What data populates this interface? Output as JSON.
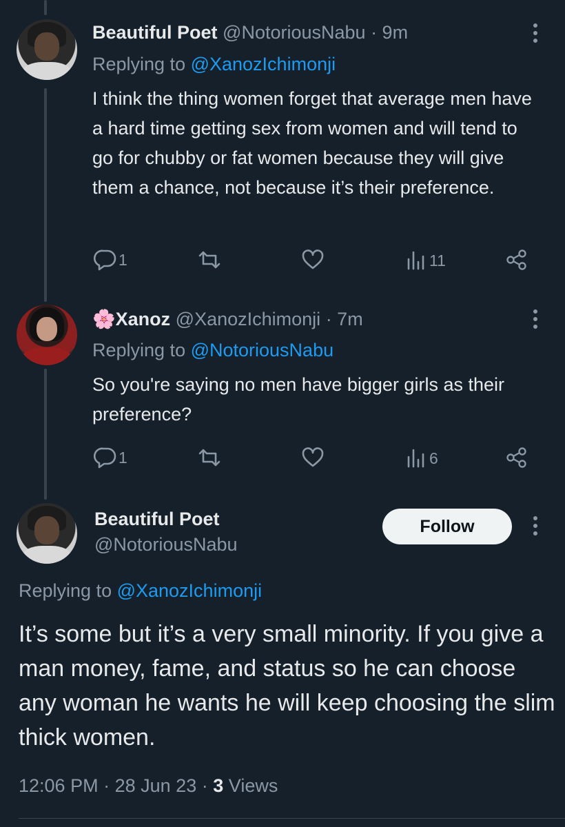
{
  "tweets": [
    {
      "name": "Beautiful Poet",
      "handle": "@NotoriousNabu",
      "time": "· 9m",
      "replying_prefix": "Replying to ",
      "replying_to": "@XanozIchimonji",
      "text": "I think the thing women forget that average men have a hard time getting sex from women and will tend to go for chubby or fat women because they will give them a chance, not because it’s their preference.",
      "replies": "1",
      "views": "11"
    },
    {
      "name_emoji": "🌸",
      "name": "Xanoz",
      "handle": "@XanozIchimonji",
      "time": "· 7m",
      "replying_prefix": "Replying to ",
      "replying_to": "@NotoriousNabu",
      "text": "So you're saying no men have bigger girls as their preference?",
      "replies": "1",
      "views": "6"
    }
  ],
  "main_tweet": {
    "name": "Beautiful Poet",
    "handle": "@NotoriousNabu",
    "follow_label": "Follow",
    "replying_prefix": "Replying to ",
    "replying_to": "@XanozIchimonji",
    "text": "It’s some but it’s a very small minority. If you give a man money, fame, and status so he can choose any woman he wants he will keep choosing the slim thick women.",
    "time": "12:06 PM",
    "date": "28 Jun 23",
    "views_count": "3",
    "views_label": "Views"
  },
  "icons": {
    "reply": "reply-icon",
    "retweet": "retweet-icon",
    "like": "heart-icon",
    "views": "views-chart-icon",
    "share": "share-icon",
    "more": "more-dots-icon"
  },
  "colors": {
    "background": "#15202b",
    "text": "#e7e9ea",
    "muted": "#8b98a5",
    "mention": "#1d9bf0",
    "button": "#eff3f4"
  }
}
